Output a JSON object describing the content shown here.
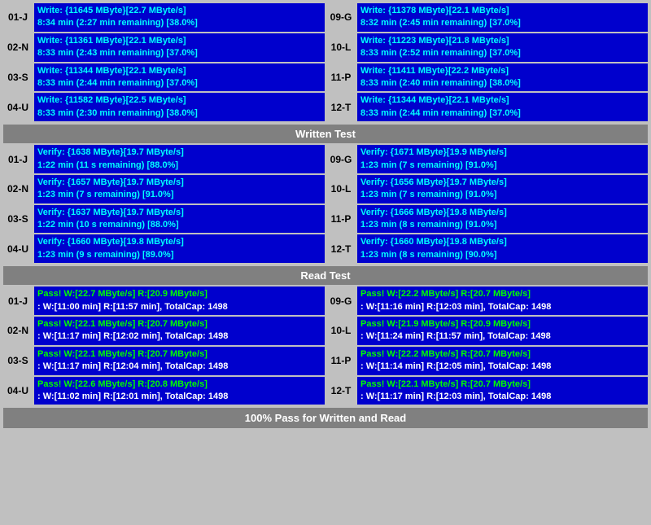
{
  "sections": {
    "write": {
      "header": "Written Test",
      "rows": [
        {
          "left_label": "01-J",
          "left_line1": "Write: {11645 MByte}[22.7 MByte/s]",
          "left_line2": "8:34 min (2:27 min remaining)  [38.0%]",
          "right_label": "09-G",
          "right_line1": "Write: {11378 MByte}[22.1 MByte/s]",
          "right_line2": "8:32 min (2:45 min remaining)  [37.0%]"
        },
        {
          "left_label": "02-N",
          "left_line1": "Write: {11361 MByte}[22.1 MByte/s]",
          "left_line2": "8:33 min (2:43 min remaining)  [37.0%]",
          "right_label": "10-L",
          "right_line1": "Write: {11223 MByte}[21.8 MByte/s]",
          "right_line2": "8:33 min (2:52 min remaining)  [37.0%]"
        },
        {
          "left_label": "03-S",
          "left_line1": "Write: {11344 MByte}[22.1 MByte/s]",
          "left_line2": "8:33 min (2:44 min remaining)  [37.0%]",
          "right_label": "11-P",
          "right_line1": "Write: {11411 MByte}[22.2 MByte/s]",
          "right_line2": "8:33 min (2:40 min remaining)  [38.0%]"
        },
        {
          "left_label": "04-U",
          "left_line1": "Write: {11582 MByte}[22.5 MByte/s]",
          "left_line2": "8:33 min (2:30 min remaining)  [38.0%]",
          "right_label": "12-T",
          "right_line1": "Write: {11344 MByte}[22.1 MByte/s]",
          "right_line2": "8:33 min (2:44 min remaining)  [37.0%]"
        }
      ]
    },
    "verify": {
      "rows": [
        {
          "left_label": "01-J",
          "left_line1": "Verify: {1638 MByte}[19.7 MByte/s]",
          "left_line2": "1:22 min (11 s remaining)   [88.0%]",
          "right_label": "09-G",
          "right_line1": "Verify: {1671 MByte}[19.9 MByte/s]",
          "right_line2": "1:23 min (7 s remaining)   [91.0%]"
        },
        {
          "left_label": "02-N",
          "left_line1": "Verify: {1657 MByte}[19.7 MByte/s]",
          "left_line2": "1:23 min (7 s remaining)   [91.0%]",
          "right_label": "10-L",
          "right_line1": "Verify: {1656 MByte}[19.7 MByte/s]",
          "right_line2": "1:23 min (7 s remaining)   [91.0%]"
        },
        {
          "left_label": "03-S",
          "left_line1": "Verify: {1637 MByte}[19.7 MByte/s]",
          "left_line2": "1:22 min (10 s remaining)   [88.0%]",
          "right_label": "11-P",
          "right_line1": "Verify: {1666 MByte}[19.8 MByte/s]",
          "right_line2": "1:23 min (8 s remaining)   [91.0%]"
        },
        {
          "left_label": "04-U",
          "left_line1": "Verify: {1660 MByte}[19.8 MByte/s]",
          "left_line2": "1:23 min (9 s remaining)   [89.0%]",
          "right_label": "12-T",
          "right_line1": "Verify: {1660 MByte}[19.8 MByte/s]",
          "right_line2": "1:23 min (8 s remaining)   [90.0%]"
        }
      ]
    },
    "read": {
      "header": "Read Test",
      "rows": [
        {
          "left_label": "01-J",
          "left_line1": "Pass! W:[22.7 MByte/s] R:[20.9 MByte/s]",
          "left_line2": ": W:[11:00 min] R:[11:57 min], TotalCap: 1498",
          "right_label": "09-G",
          "right_line1": "Pass! W:[22.2 MByte/s] R:[20.7 MByte/s]",
          "right_line2": ": W:[11:16 min] R:[12:03 min], TotalCap: 1498"
        },
        {
          "left_label": "02-N",
          "left_line1": "Pass! W:[22.1 MByte/s] R:[20.7 MByte/s]",
          "left_line2": ": W:[11:17 min] R:[12:02 min], TotalCap: 1498",
          "right_label": "10-L",
          "right_line1": "Pass! W:[21.9 MByte/s] R:[20.9 MByte/s]",
          "right_line2": ": W:[11:24 min] R:[11:57 min], TotalCap: 1498"
        },
        {
          "left_label": "03-S",
          "left_line1": "Pass! W:[22.1 MByte/s] R:[20.7 MByte/s]",
          "left_line2": ": W:[11:17 min] R:[12:04 min], TotalCap: 1498",
          "right_label": "11-P",
          "right_line1": "Pass! W:[22.2 MByte/s] R:[20.7 MByte/s]",
          "right_line2": ": W:[11:14 min] R:[12:05 min], TotalCap: 1498"
        },
        {
          "left_label": "04-U",
          "left_line1": "Pass! W:[22.6 MByte/s] R:[20.8 MByte/s]",
          "left_line2": ": W:[11:02 min] R:[12:01 min], TotalCap: 1498",
          "right_label": "12-T",
          "right_line1": "Pass! W:[22.1 MByte/s] R:[20.7 MByte/s]",
          "right_line2": ": W:[11:17 min] R:[12:03 min], TotalCap: 1498"
        }
      ]
    }
  },
  "footer": {
    "label": "100% Pass for Written and Read"
  }
}
